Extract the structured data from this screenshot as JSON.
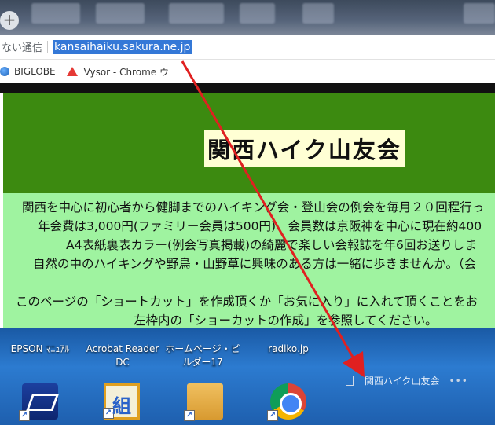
{
  "browser": {
    "new_tab_symbol": "+",
    "security_label": "ない通信",
    "url": "kansaihaiku.sakura.ne.jp",
    "bookmarks": [
      {
        "label": "BIGLOBE",
        "icon": "globe-icon"
      },
      {
        "label": "Vysor - Chrome ウ",
        "icon": "vysor-icon"
      }
    ]
  },
  "page": {
    "title": "関西ハイク山友会",
    "intro_lines": [
      "関西を中心に初心者から健脚までのハイキング会・登山会の例会を毎月２０回程行っ",
      "年会費は3,000円(ファミリー会員は500円)、会員数は京阪神を中心に現在約400",
      "A4表紙裏表カラー(例会写真掲載)の綺麗で楽しい会報誌を年6回お送りしま",
      "自然の中のハイキングや野鳥・山野草に興味のある方は一緒に歩きませんか。（会",
      "",
      "このページの「ショートカット」を作成頂くか「お気に入り」に入れて頂くことをお",
      "左枠内の「ショーカットの作成」を参照してください。"
    ],
    "colors": {
      "banner": "#3c8a10",
      "intro_bg": "#9ff3a0",
      "title_bg": "#ffffd4"
    }
  },
  "desktop": {
    "labels": [
      {
        "text": "EPSON ﾏﾆｭｱﾙ"
      },
      {
        "text": "Acrobat Reader DC"
      },
      {
        "text": "ホームページ・ビルダー17"
      },
      {
        "text": "radiko.jp"
      }
    ],
    "icons": [
      "scanner-icon",
      "book-icon",
      "folder-icon",
      "chrome-icon"
    ],
    "dragged_file": {
      "label": "関西ハイク山友会",
      "more": "•••"
    }
  },
  "annotation": {
    "arrow_color": "#e02020"
  }
}
